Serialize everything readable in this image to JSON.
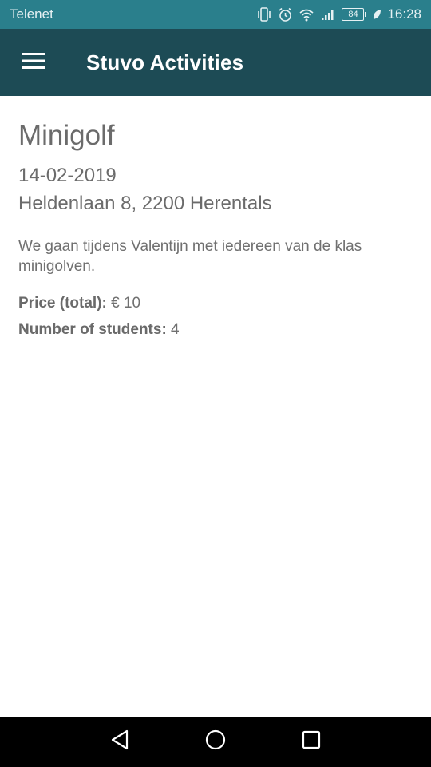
{
  "status_bar": {
    "carrier": "Telenet",
    "battery_level": "84",
    "time": "16:28",
    "icons": [
      "vibrate-icon",
      "alarm-icon",
      "wifi-icon",
      "signal-icon",
      "battery-icon",
      "leaf-icon"
    ]
  },
  "app_bar": {
    "title": "Stuvo Activities",
    "menu_icon": "hamburger-menu-icon"
  },
  "activity": {
    "title": "Minigolf",
    "date": "14-02-2019",
    "address": "Heldenlaan 8, 2200 Herentals",
    "description": "We gaan tijdens Valentijn met iedereen van de klas minigolven.",
    "price_label": "Price (total):",
    "price_value": " € 10",
    "students_label": "Number of students:",
    "students_value": " 4"
  },
  "nav_bar": {
    "icons": [
      "back-icon",
      "home-icon",
      "recents-icon"
    ]
  },
  "colors": {
    "status_bar": "#2a7f8c",
    "app_bar": "#1d4b55",
    "text": "#6e6e6e",
    "nav_bar": "#000000"
  }
}
